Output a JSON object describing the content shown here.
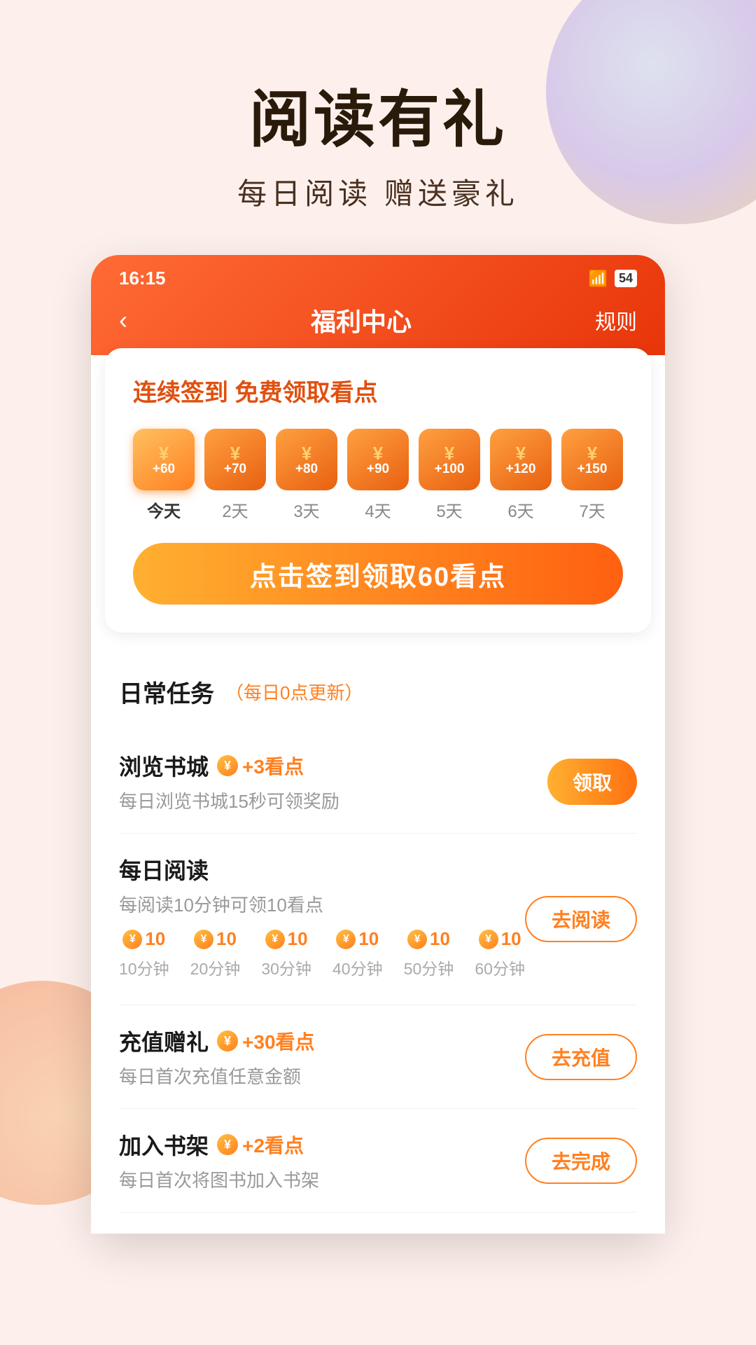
{
  "page": {
    "background_color": "#fdf0ec"
  },
  "header": {
    "main_title": "阅读有礼",
    "sub_title": "每日阅读  赠送豪礼"
  },
  "status_bar": {
    "time": "16:15",
    "battery": "54",
    "wifi_icon": "wifi"
  },
  "nav": {
    "back_icon": "‹",
    "title": "福利中心",
    "rules": "规则"
  },
  "checkin": {
    "title": "连续签到 免费领取看点",
    "days": [
      {
        "amount": "+60",
        "label": "今天",
        "today": true
      },
      {
        "amount": "+70",
        "label": "2天",
        "today": false
      },
      {
        "amount": "+80",
        "label": "3天",
        "today": false
      },
      {
        "amount": "+90",
        "label": "4天",
        "today": false
      },
      {
        "amount": "+100",
        "label": "5天",
        "today": false
      },
      {
        "amount": "+120",
        "label": "6天",
        "today": false
      },
      {
        "amount": "+150",
        "label": "7天",
        "today": false
      }
    ],
    "btn_label": "点击签到领取60看点"
  },
  "tasks": {
    "title": "日常任务",
    "subtitle": "（每日0点更新）",
    "items": [
      {
        "name": "浏览书城",
        "points": "+3看点",
        "desc": "每日浏览书城15秒可领奖励",
        "btn": "领取",
        "btn_filled": true
      },
      {
        "name": "每日阅读",
        "points": "",
        "desc": "每阅读10分钟可领10看点",
        "btn": "去阅读",
        "btn_filled": false,
        "progress": [
          {
            "num": "10",
            "time": "10分钟"
          },
          {
            "num": "10",
            "time": "20分钟"
          },
          {
            "num": "10",
            "time": "30分钟"
          },
          {
            "num": "10",
            "time": "40分钟"
          },
          {
            "num": "10",
            "time": "50分钟"
          },
          {
            "num": "10",
            "time": "60分钟"
          }
        ]
      },
      {
        "name": "充值赠礼",
        "points": "+30看点",
        "desc": "每日首次充值任意金额",
        "btn": "去充值",
        "btn_filled": false
      },
      {
        "name": "加入书架",
        "points": "+2看点",
        "desc": "每日首次将图书加入书架",
        "btn": "去完成",
        "btn_filled": false
      }
    ]
  }
}
